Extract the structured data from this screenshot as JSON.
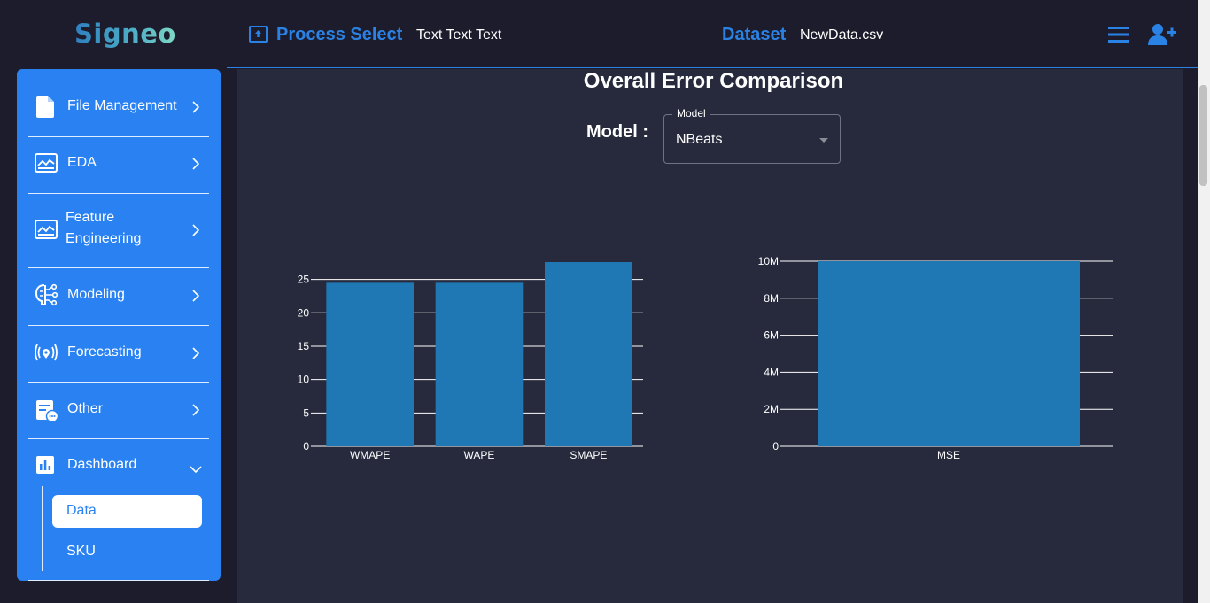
{
  "header": {
    "logo": "Signeo",
    "process_title": "Process Select",
    "process_sub": "Text Text Text",
    "dataset_title": "Dataset",
    "dataset_value": "NewData.csv",
    "accent_color": "#2a82e4"
  },
  "sidebar": {
    "items": [
      {
        "label": "File Management",
        "icon": "file-icon"
      },
      {
        "label": "EDA",
        "icon": "chart-image-icon"
      },
      {
        "label": "Feature",
        "label2": "Engineering",
        "icon": "chart-image-icon"
      },
      {
        "label": "Modeling",
        "icon": "brain-network-icon"
      },
      {
        "label": "Forecasting",
        "icon": "broadcast-icon"
      },
      {
        "label": "Other",
        "icon": "document-chat-icon"
      },
      {
        "label": "Dashboard",
        "icon": "bar-chart-icon"
      }
    ],
    "sub_items": [
      {
        "label": "Data",
        "active": true
      },
      {
        "label": "SKU",
        "active": false
      }
    ],
    "color": "#2a82f2"
  },
  "main": {
    "title": "Overall Error Comparison",
    "model_label": "Model :",
    "model_select": {
      "legend": "Model",
      "value": "NBeats"
    }
  },
  "chart_data": [
    {
      "type": "bar",
      "categories": [
        "WMAPE",
        "WAPE",
        "SMAPE"
      ],
      "values": [
        24.5,
        24.5,
        27.6
      ],
      "ylim": [
        0,
        27.6
      ],
      "yticks": [
        0,
        5,
        10,
        15,
        20,
        25
      ],
      "ytick_labels": [
        "0",
        "5",
        "10",
        "15",
        "20",
        "25"
      ],
      "grid": true,
      "color": "#1f77b4"
    },
    {
      "type": "bar",
      "categories": [
        "MSE"
      ],
      "values": [
        10000000
      ],
      "ylim": [
        0,
        10000000
      ],
      "yticks": [
        0,
        2000000,
        4000000,
        6000000,
        8000000,
        10000000
      ],
      "ytick_labels": [
        "0",
        "2M",
        "4M",
        "6M",
        "8M",
        "10M"
      ],
      "grid": true,
      "color": "#1f77b4"
    }
  ]
}
